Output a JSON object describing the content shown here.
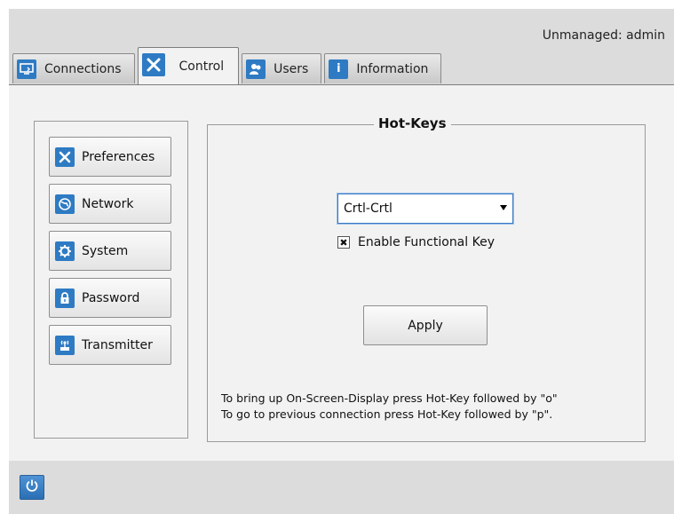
{
  "header": {
    "user_status": "Unmanaged: admin"
  },
  "tabs": [
    {
      "label": "Connections",
      "icon": "connections-icon"
    },
    {
      "label": "Control",
      "icon": "wrench-screwdriver-icon",
      "active": true
    },
    {
      "label": "Users",
      "icon": "users-icon"
    },
    {
      "label": "Information",
      "icon": "info-icon"
    }
  ],
  "sidebar": {
    "items": [
      {
        "label": "Preferences",
        "icon": "wrench-screwdriver-icon"
      },
      {
        "label": "Network",
        "icon": "globe-icon"
      },
      {
        "label": "System",
        "icon": "gear-icon"
      },
      {
        "label": "Password",
        "icon": "lock-icon"
      },
      {
        "label": "Transmitter",
        "icon": "transmitter-icon"
      }
    ]
  },
  "hotkeys": {
    "title": "Hot-Keys",
    "selected_hotkey": "Crtl-Crtl",
    "functional_key_label": "Enable Functional Key",
    "functional_key_checked": true,
    "apply_label": "Apply",
    "hint_line1": "To bring up On-Screen-Display press Hot-Key followed by \"o\"",
    "hint_line2": "To go to previous connection press Hot-Key followed by \"p\"."
  },
  "footer": {
    "power_icon": "power-icon"
  },
  "colors": {
    "accent": "#2e7bc4",
    "panel_bg": "#f2f2f2",
    "bar_bg": "#dcdcdc"
  }
}
